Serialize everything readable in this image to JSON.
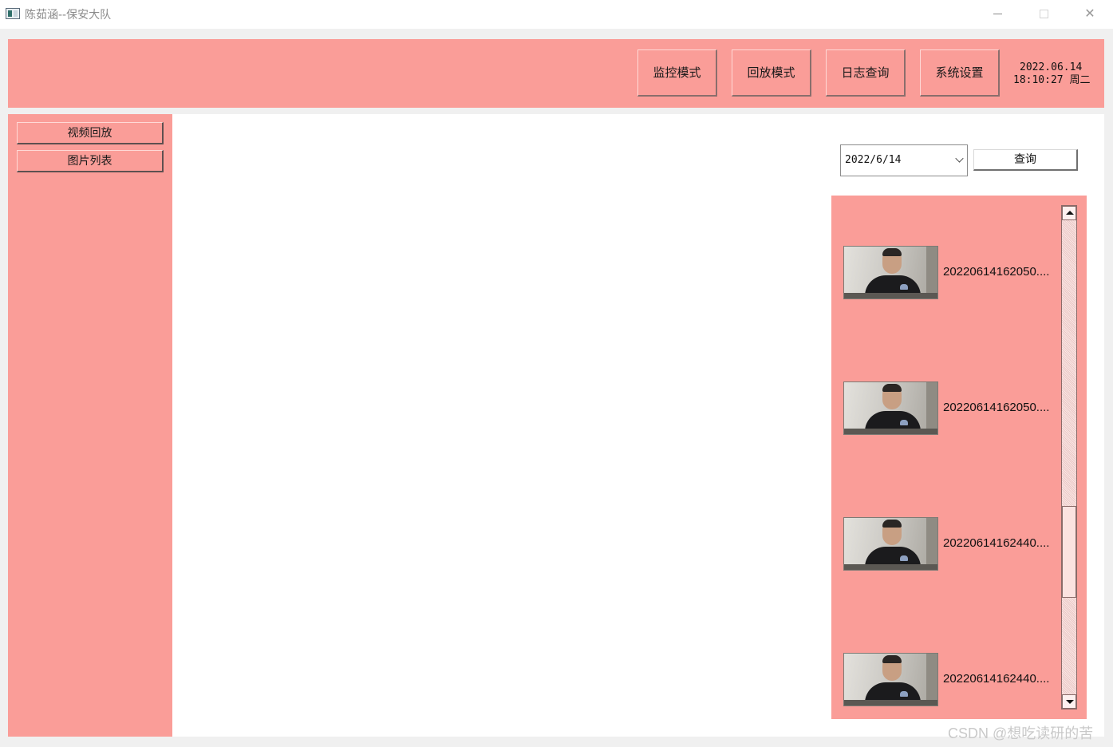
{
  "window": {
    "title": "陈茹涵--保安大队",
    "icon": "app-window-icon",
    "controls": [
      "minimize-icon",
      "maximize-icon",
      "close-icon"
    ]
  },
  "header": {
    "modes": [
      {
        "label": "监控模式"
      },
      {
        "label": "回放模式"
      },
      {
        "label": "日志查询"
      },
      {
        "label": "系统设置"
      }
    ],
    "date": "2022.06.14",
    "time": "18:10:27",
    "weekday": "周二"
  },
  "sidebar": {
    "items": [
      {
        "label": "视频回放"
      },
      {
        "label": "图片列表"
      }
    ]
  },
  "search": {
    "date_value": "2022/6/14",
    "query_label": "查询"
  },
  "image_list": {
    "items": [
      {
        "filename": "20220614162050...."
      },
      {
        "filename": "20220614162050...."
      },
      {
        "filename": "20220614162440...."
      },
      {
        "filename": "20220614162440...."
      }
    ]
  },
  "watermark": "CSDN @想吃读研的苦",
  "colors": {
    "panel_pink": "#fa9d98",
    "window_bg": "#f0f0f0"
  }
}
